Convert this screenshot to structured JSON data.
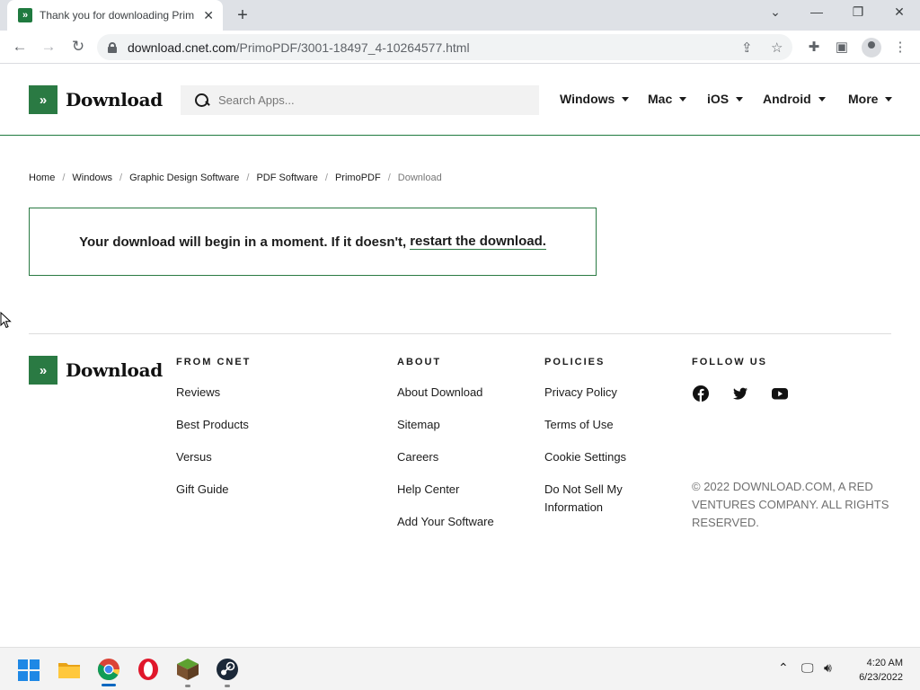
{
  "browser": {
    "tab_title": "Thank you for downloading Prim",
    "tab_favicon": "download-favicon",
    "url_domain": "download.cnet.com",
    "url_path": "/PrimoPDF/3001-18497_4-10264577.html",
    "icons": [
      "back-icon",
      "forward-icon",
      "reload-icon",
      "lock-icon",
      "share-icon",
      "star-icon",
      "extensions-icon",
      "sidepanel-icon",
      "profile-icon",
      "menu-icon",
      "minimize-icon",
      "restore-icon",
      "close-icon",
      "tab-search-icon"
    ]
  },
  "header": {
    "logo_text": "Download",
    "search_placeholder": "Search Apps...",
    "nav": [
      {
        "label": "Windows"
      },
      {
        "label": "Mac"
      },
      {
        "label": "iOS"
      },
      {
        "label": "Android"
      },
      {
        "label": "More"
      }
    ]
  },
  "breadcrumb": [
    "Home",
    "Windows",
    "Graphic Design Software",
    "PDF Software",
    "PrimoPDF",
    "Download"
  ],
  "notice": {
    "text": "Your download will begin in a moment. If it doesn't,",
    "link": "restart the download."
  },
  "footer": {
    "logo_text": "Download",
    "from_cnet": {
      "heading": "FROM CNET",
      "links": [
        "Reviews",
        "Best Products",
        "Versus",
        "Gift Guide"
      ]
    },
    "about": {
      "heading": "ABOUT",
      "links": [
        "About Download",
        "Sitemap",
        "Careers",
        "Help Center",
        "Add Your Software"
      ]
    },
    "policies": {
      "heading": "POLICIES",
      "links": [
        "Privacy Policy",
        "Terms of Use",
        "Cookie Settings",
        "Do Not Sell My Information"
      ]
    },
    "follow": {
      "heading": "FOLLOW US",
      "icons": [
        "facebook-icon",
        "twitter-icon",
        "youtube-icon"
      ]
    },
    "copyright": "© 2022 DOWNLOAD.COM, A RED VENTURES COMPANY. ALL RIGHTS RESERVED."
  },
  "taskbar": {
    "apps": [
      "windows-start-icon",
      "file-explorer-icon",
      "chrome-icon",
      "opera-icon",
      "minecraft-icon",
      "steam-icon"
    ],
    "time": "4:20 AM",
    "date": "6/23/2022"
  },
  "colors": {
    "brand_green": "#2a7a43",
    "chrome_bg": "#dee1e6"
  }
}
